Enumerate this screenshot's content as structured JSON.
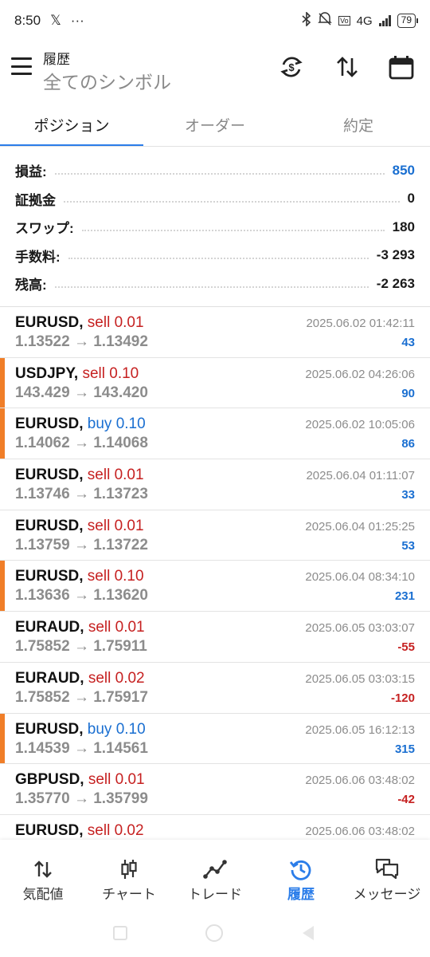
{
  "status": {
    "time": "8:50",
    "x_glyph": "𝕏",
    "more": "···",
    "network": "4G",
    "battery": "79"
  },
  "header": {
    "section": "履歴",
    "filter": "全てのシンボル"
  },
  "tabs": [
    {
      "label": "ポジション",
      "active": true
    },
    {
      "label": "オーダー",
      "active": false
    },
    {
      "label": "約定",
      "active": false
    }
  ],
  "summary": [
    {
      "label": "損益:",
      "value": "850",
      "color": "blue"
    },
    {
      "label": "証拠金",
      "value": "0",
      "color": "black"
    },
    {
      "label": "スワップ:",
      "value": "180",
      "color": "black"
    },
    {
      "label": "手数料:",
      "value": "-3 293",
      "color": "black"
    },
    {
      "label": "残高:",
      "value": "-2 263",
      "color": "black"
    }
  ],
  "deals": [
    {
      "symbol": "EURUSD,",
      "side": "sell 0.01",
      "prices": "1.13522 → 1.13492",
      "time": "2025.06.02 01:42:11",
      "profit": "43",
      "marked": false
    },
    {
      "symbol": "USDJPY,",
      "side": "sell 0.10",
      "prices": "143.429 → 143.420",
      "time": "2025.06.02 04:26:06",
      "profit": "90",
      "marked": true
    },
    {
      "symbol": "EURUSD,",
      "side": "buy 0.10",
      "prices": "1.14062 → 1.14068",
      "time": "2025.06.02 10:05:06",
      "profit": "86",
      "marked": true
    },
    {
      "symbol": "EURUSD,",
      "side": "sell 0.01",
      "prices": "1.13746 → 1.13723",
      "time": "2025.06.04 01:11:07",
      "profit": "33",
      "marked": false
    },
    {
      "symbol": "EURUSD,",
      "side": "sell 0.01",
      "prices": "1.13759 → 1.13722",
      "time": "2025.06.04 01:25:25",
      "profit": "53",
      "marked": false
    },
    {
      "symbol": "EURUSD,",
      "side": "sell 0.10",
      "prices": "1.13636 → 1.13620",
      "time": "2025.06.04 08:34:10",
      "profit": "231",
      "marked": true
    },
    {
      "symbol": "EURAUD,",
      "side": "sell 0.01",
      "prices": "1.75852 → 1.75911",
      "time": "2025.06.05 03:03:07",
      "profit": "-55",
      "marked": false
    },
    {
      "symbol": "EURAUD,",
      "side": "sell 0.02",
      "prices": "1.75852 → 1.75917",
      "time": "2025.06.05 03:03:15",
      "profit": "-120",
      "marked": false
    },
    {
      "symbol": "EURUSD,",
      "side": "buy 0.10",
      "prices": "1.14539 → 1.14561",
      "time": "2025.06.05 16:12:13",
      "profit": "315",
      "marked": true
    },
    {
      "symbol": "GBPUSD,",
      "side": "sell 0.01",
      "prices": "1.35770 → 1.35799",
      "time": "2025.06.06 03:48:02",
      "profit": "-42",
      "marked": false
    },
    {
      "symbol": "EURUSD,",
      "side": "sell 0.02",
      "prices": "",
      "time": "2025.06.06 03:48:02",
      "profit": "",
      "marked": false
    }
  ],
  "nav": [
    {
      "label": "気配値",
      "icon": "quotes-icon",
      "active": false
    },
    {
      "label": "チャート",
      "icon": "chart-icon",
      "active": false
    },
    {
      "label": "トレード",
      "icon": "trade-icon",
      "active": false
    },
    {
      "label": "履歴",
      "icon": "history-icon",
      "active": true
    },
    {
      "label": "メッセージ",
      "icon": "messages-icon",
      "active": false
    }
  ],
  "colors": {
    "accent": "#2b7de9",
    "buy": "#1a6fd1",
    "sell": "#c62121",
    "marker": "#f07e28"
  }
}
